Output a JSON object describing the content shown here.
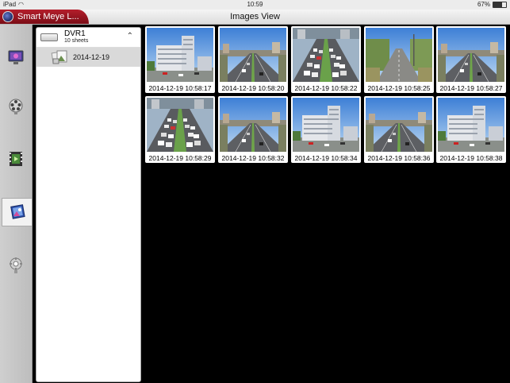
{
  "status": {
    "device": "iPad",
    "time": "10:59",
    "battery": "67%"
  },
  "header": {
    "app_name": "Smart Meye L...",
    "title": "Images View"
  },
  "rail": {
    "items": [
      "images-view",
      "playback",
      "video",
      "pictures",
      "settings"
    ],
    "active": "pictures"
  },
  "tree": {
    "device_name": "DVR1",
    "device_sheets": "10 sheets",
    "dates": [
      "2014-12-19"
    ]
  },
  "thumbnails": [
    {
      "time": "2014-12-19 10:58:17",
      "scene": "building"
    },
    {
      "time": "2014-12-19 10:58:20",
      "scene": "road"
    },
    {
      "time": "2014-12-19 10:58:22",
      "scene": "traffic"
    },
    {
      "time": "2014-12-19 10:58:25",
      "scene": "road-trees"
    },
    {
      "time": "2014-12-19 10:58:27",
      "scene": "road"
    },
    {
      "time": "2014-12-19 10:58:29",
      "scene": "traffic"
    },
    {
      "time": "2014-12-19 10:58:32",
      "scene": "road"
    },
    {
      "time": "2014-12-19 10:58:34",
      "scene": "building"
    },
    {
      "time": "2014-12-19 10:58:36",
      "scene": "road"
    },
    {
      "time": "2014-12-19 10:58:38",
      "scene": "building"
    }
  ]
}
